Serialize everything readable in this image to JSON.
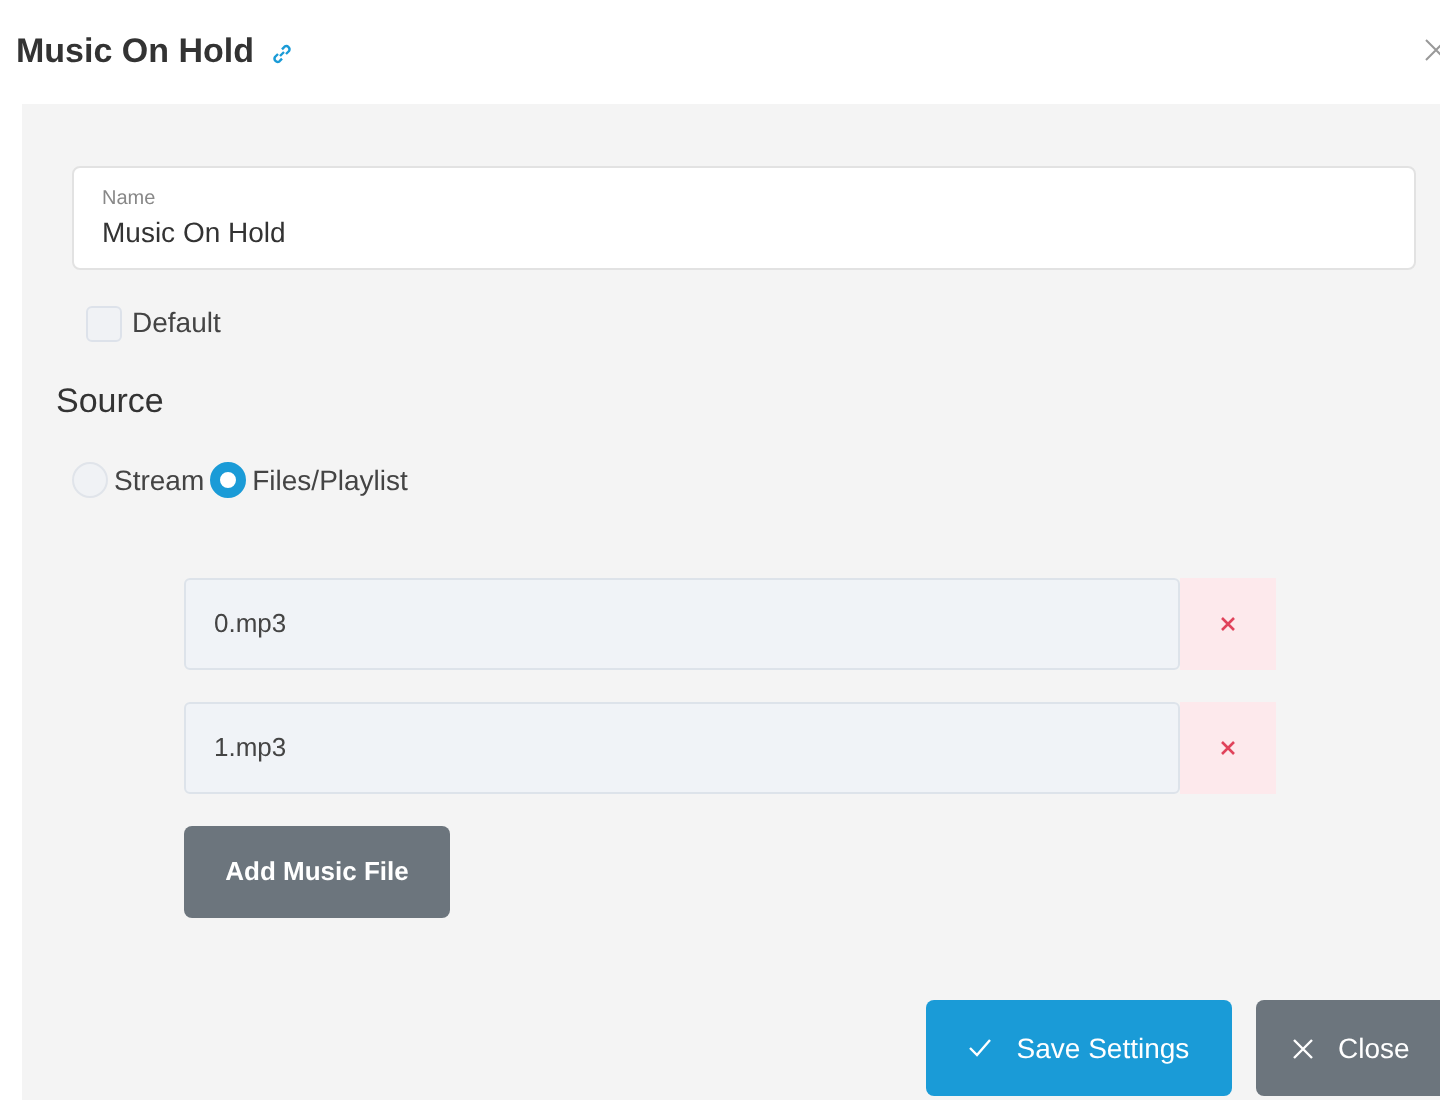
{
  "title": "Music On Hold",
  "name_field": {
    "label": "Name",
    "value": "Music On Hold"
  },
  "default_checkbox": {
    "label": "Default",
    "checked": false
  },
  "source": {
    "heading": "Source",
    "options": [
      {
        "label": "Stream",
        "selected": false
      },
      {
        "label": "Files/Playlist",
        "selected": true
      }
    ]
  },
  "files": [
    {
      "value": "0.mp3"
    },
    {
      "value": "1.mp3"
    }
  ],
  "add_button": "Add Music File",
  "footer_buttons": [
    {
      "kind": "save",
      "label": "Save Settings"
    },
    {
      "kind": "close",
      "label": "Close"
    }
  ]
}
